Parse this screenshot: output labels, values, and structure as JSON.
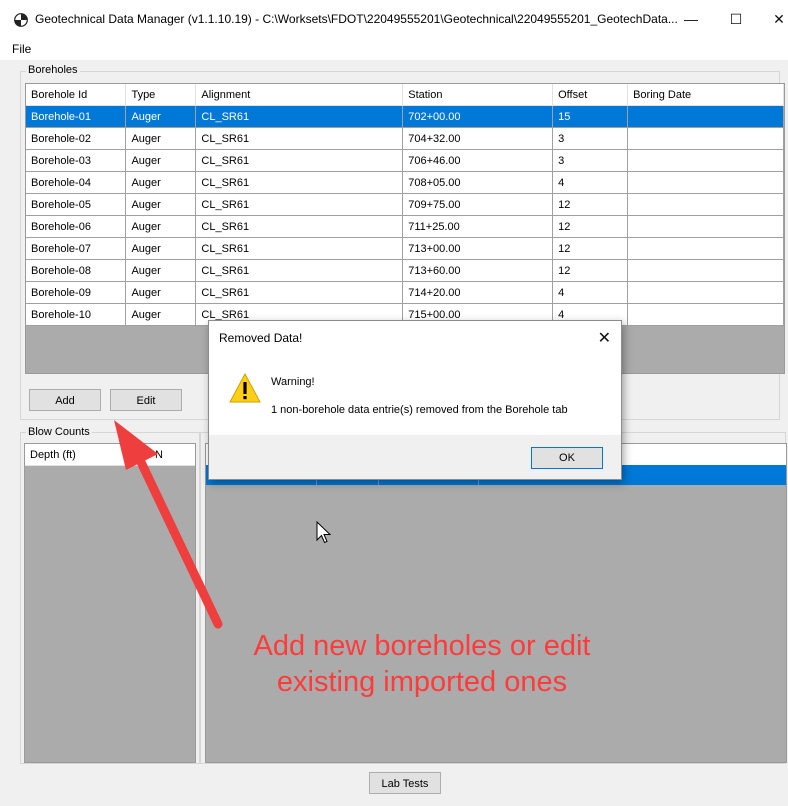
{
  "window": {
    "title": "Geotechnical Data Manager (v1.1.10.19) - C:\\Worksets\\FDOT\\22049555201\\Geotechnical\\22049555201_GeotechData...",
    "minimize": "—",
    "maximize": "☐",
    "close": "✕"
  },
  "menu": {
    "file": "File"
  },
  "boreholes": {
    "group_label": "Boreholes",
    "columns": [
      "Borehole Id",
      "Type",
      "Alignment",
      "Station",
      "Offset",
      "Boring Date"
    ],
    "rows": [
      [
        "Borehole-01",
        "Auger",
        "CL_SR61",
        "702+00.00",
        "15",
        ""
      ],
      [
        "Borehole-02",
        "Auger",
        "CL_SR61",
        "704+32.00",
        "3",
        ""
      ],
      [
        "Borehole-03",
        "Auger",
        "CL_SR61",
        "706+46.00",
        "3",
        ""
      ],
      [
        "Borehole-04",
        "Auger",
        "CL_SR61",
        "708+05.00",
        "4",
        ""
      ],
      [
        "Borehole-05",
        "Auger",
        "CL_SR61",
        "709+75.00",
        "12",
        ""
      ],
      [
        "Borehole-06",
        "Auger",
        "CL_SR61",
        "711+25.00",
        "12",
        ""
      ],
      [
        "Borehole-07",
        "Auger",
        "CL_SR61",
        "713+00.00",
        "12",
        ""
      ],
      [
        "Borehole-08",
        "Auger",
        "CL_SR61",
        "713+60.00",
        "12",
        ""
      ],
      [
        "Borehole-09",
        "Auger",
        "CL_SR61",
        "714+20.00",
        "4",
        ""
      ],
      [
        "Borehole-10",
        "Auger",
        "CL_SR61",
        "715+00.00",
        "4",
        ""
      ]
    ],
    "add_label": "Add",
    "edit_label": "Edit"
  },
  "blow_counts": {
    "group_label": "Blow Counts",
    "columns": [
      "Depth (ft)",
      "SPT-N"
    ]
  },
  "lab_tests_label": "Lab Tests",
  "dialog": {
    "title": "Removed Data!",
    "close": "✕",
    "heading": "Warning!",
    "message": "1 non-borehole data entrie(s) removed from the Borehole tab",
    "ok_label": "OK"
  },
  "annotation": {
    "line1": "Add new boreholes or edit",
    "line2": "existing imported ones",
    "color": "#ff3b3b"
  },
  "colors": {
    "selection": "#0078d7",
    "grid_empty": "#ababab"
  }
}
